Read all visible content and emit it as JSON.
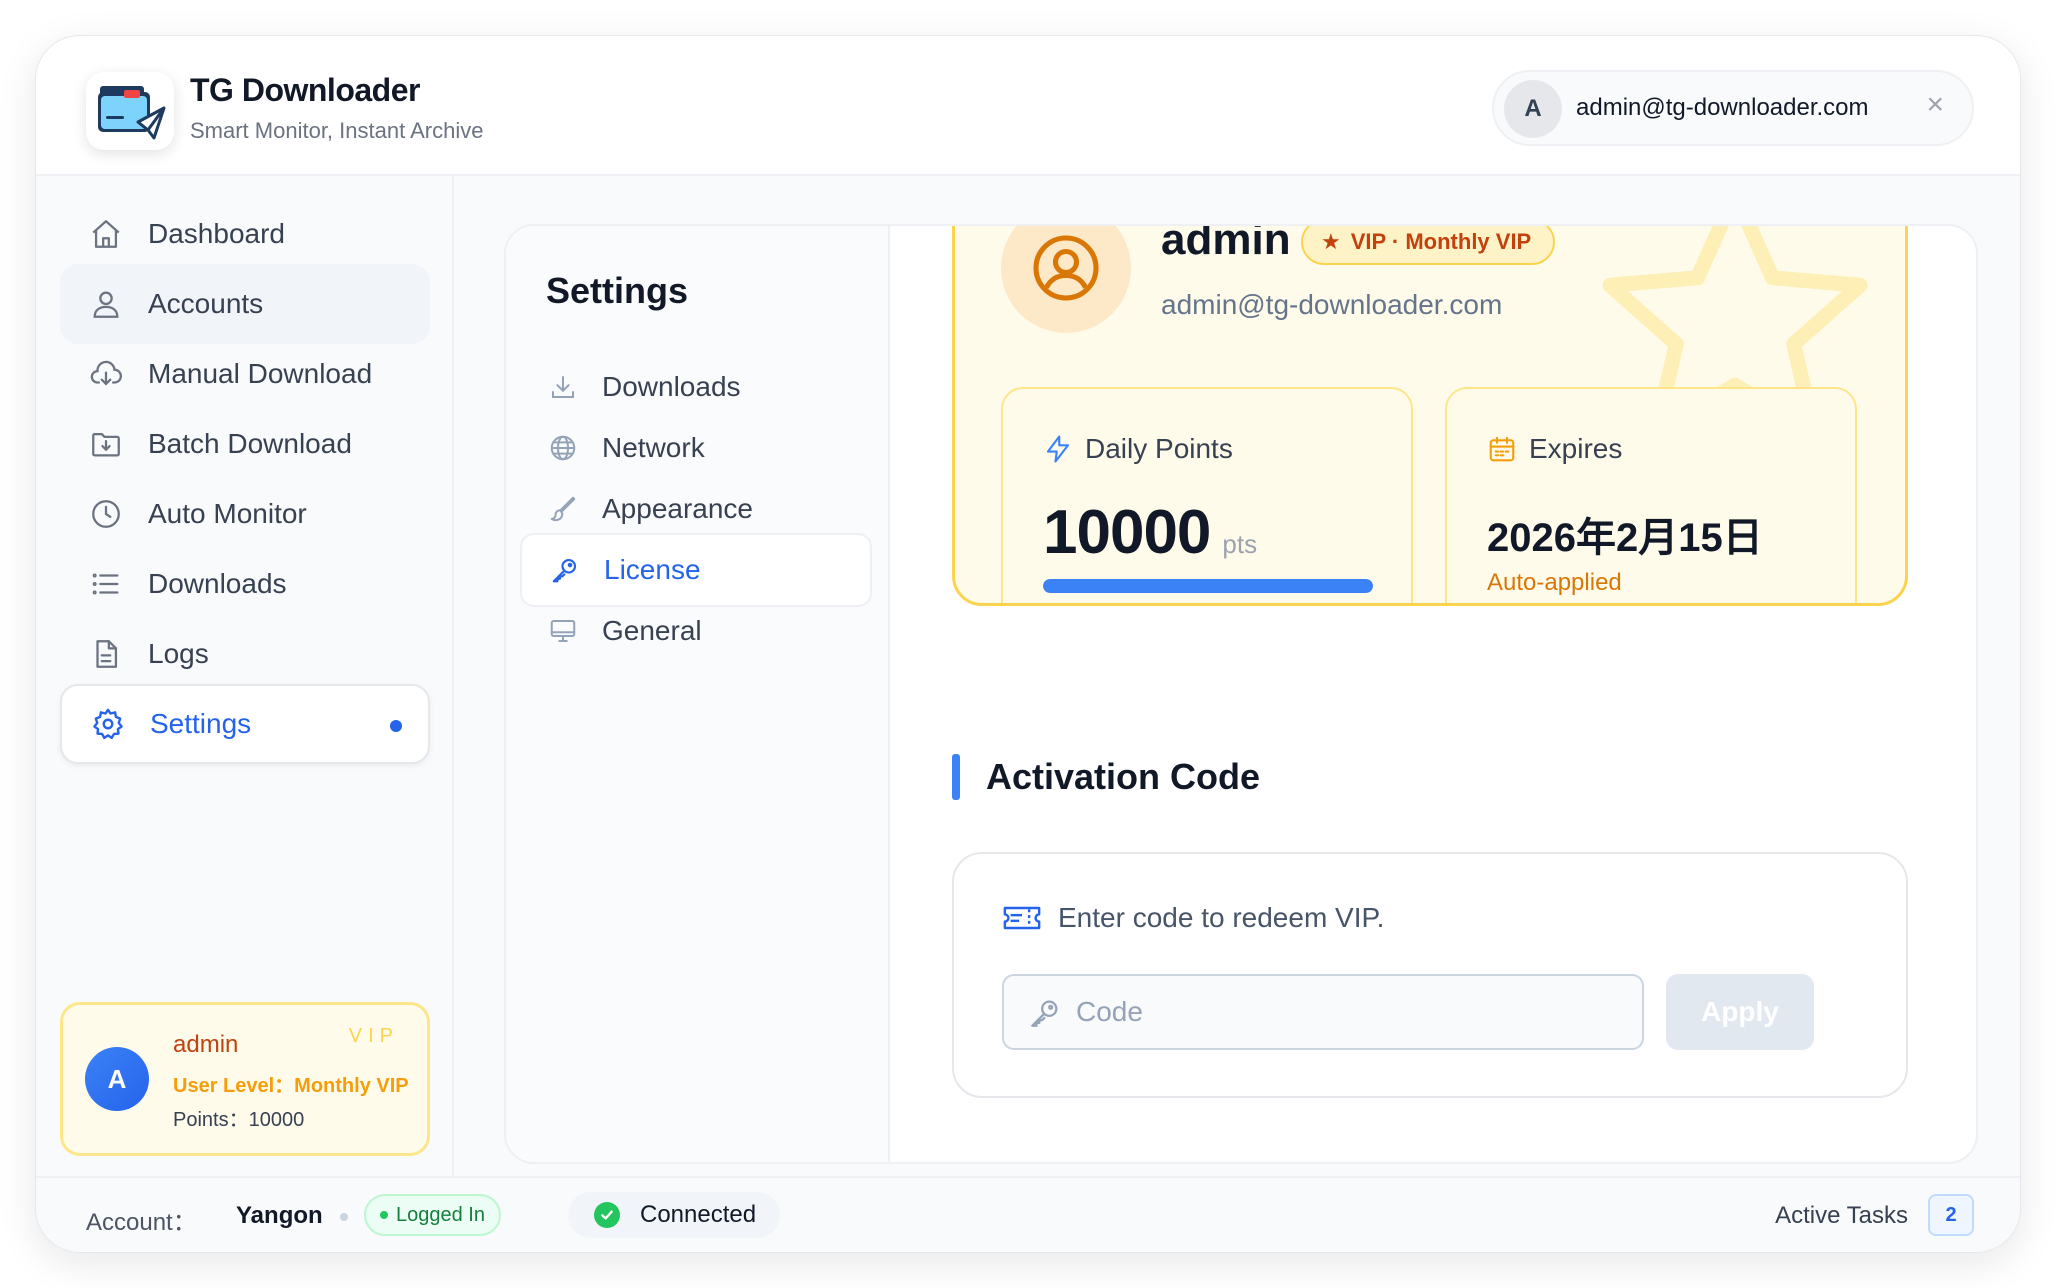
{
  "app": {
    "title": "TG Downloader",
    "subtitle": "Smart Monitor, Instant Archive"
  },
  "header_user": {
    "avatar_letter": "A",
    "email": "admin@tg-downloader.com",
    "close": "×"
  },
  "sidebar": {
    "items": [
      {
        "label": "Dashboard",
        "icon": "home-icon"
      },
      {
        "label": "Accounts",
        "icon": "user-icon"
      },
      {
        "label": "Manual Download",
        "icon": "cloud-download-icon"
      },
      {
        "label": "Batch Download",
        "icon": "folder-download-icon"
      },
      {
        "label": "Auto Monitor",
        "icon": "clock-icon"
      },
      {
        "label": "Downloads",
        "icon": "list-icon"
      },
      {
        "label": "Logs",
        "icon": "file-icon"
      },
      {
        "label": "Settings",
        "icon": "gear-icon",
        "active": true
      }
    ],
    "user_card": {
      "avatar_letter": "A",
      "name": "admin",
      "vip": "VIP",
      "level": "User Level：Monthly VIP",
      "points": "Points：10000"
    }
  },
  "settings": {
    "title": "Settings",
    "items": [
      {
        "label": "Downloads",
        "icon": "download-icon"
      },
      {
        "label": "Network",
        "icon": "globe-icon"
      },
      {
        "label": "Appearance",
        "icon": "brush-icon"
      },
      {
        "label": "License",
        "icon": "key-icon",
        "active": true
      },
      {
        "label": "General",
        "icon": "monitor-icon"
      }
    ]
  },
  "license": {
    "profile": {
      "name": "admin",
      "badge": "VIP · Monthly VIP",
      "email": "admin@tg-downloader.com"
    },
    "daily_points": {
      "label": "Daily Points",
      "value": "10000",
      "unit": "pts",
      "progress": 1.0
    },
    "expires": {
      "label": "Expires",
      "value": "2026年2月15日",
      "note": "Auto-applied"
    },
    "activation": {
      "title": "Activation Code",
      "hint": "Enter code to redeem VIP.",
      "placeholder": "Code",
      "value": "",
      "apply_label": "Apply"
    }
  },
  "footer": {
    "account_label": "Account：",
    "account_name": "Yangon",
    "status": "Logged In",
    "connection": "Connected",
    "tasks_label": "Active Tasks",
    "tasks_count": "2"
  },
  "colors": {
    "accent": "#2563eb",
    "vip": "#f59e0b",
    "success": "#22c55e"
  }
}
